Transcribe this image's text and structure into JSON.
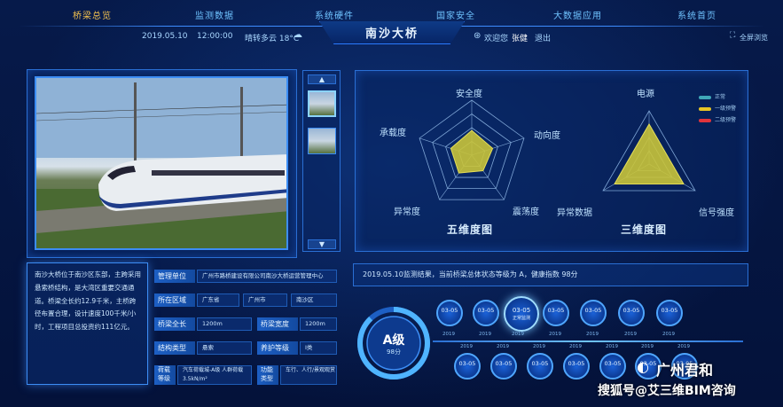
{
  "nav": {
    "items": [
      "桥梁总览",
      "监测数据",
      "系统硬件",
      "国家安全",
      "大数据应用",
      "系统首页"
    ],
    "active_index": 0
  },
  "infobar": {
    "date": "2019.05.10",
    "time": "12:00:00",
    "weather": "晴转多云 18°C",
    "welcome": "欢迎您",
    "user": "张健",
    "logout": "退出",
    "fullscreen": "全屏浏览"
  },
  "title": "南沙大桥",
  "radar1": {
    "labels": [
      "安全度",
      "动向度",
      "震荡度",
      "异常度",
      "承载度"
    ],
    "title": "五维度图",
    "values": [
      0.45,
      0.4,
      0.35,
      0.4,
      0.4
    ]
  },
  "radar2": {
    "labels": [
      "电源",
      "信号强度",
      "异常数据"
    ],
    "title": "三维度图",
    "values": [
      0.75,
      0.75,
      0.75
    ],
    "legend": [
      {
        "label": "正常",
        "color": "#3fa7b8"
      },
      {
        "label": "一级预警",
        "color": "#e6c425"
      },
      {
        "label": "二级预警",
        "color": "#e0343c"
      }
    ]
  },
  "description": "南沙大桥位于南沙区东部，主跨采用悬索桥结构，是大湾区重要交通通道。桥梁全长约12.9千米，主桥跨径布置合理，设计速度100千米/小时，工程项目总投资约111亿元。",
  "info": {
    "mgmt_label": "管理单位",
    "mgmt_value": "广州市路桥建设有限公司南沙大桥运营管理中心",
    "area_label": "所在区域",
    "area_value1": "广东省",
    "area_value2": "广州市",
    "area_value3": "南沙区",
    "length_label": "桥梁全长",
    "length_value": "1200m",
    "width_label": "桥梁宽度",
    "width_value": "1200m",
    "type_label": "结构类型",
    "type_value": "悬索",
    "guard_label": "养护等级",
    "guard_value": "I类",
    "load_label": "荷载等级",
    "load_value": "汽车荷载城-A级 人群荷载3.5kN/m²",
    "func_label": "功能类型",
    "func_value": "车行、人行/景观观赏"
  },
  "status_msg": "2019.05.10监测结果，当前桥梁总体状态等级为 A，健康指数 98分",
  "grade": {
    "level": "A级",
    "score": "98分"
  },
  "timeline_top": [
    {
      "date": "03-05",
      "year": "2019",
      "label": ""
    },
    {
      "date": "03-05",
      "year": "2019",
      "label": ""
    },
    {
      "date": "03-05",
      "year": "2019",
      "label": "正常监测"
    },
    {
      "date": "03-05",
      "year": "2019",
      "label": ""
    },
    {
      "date": "03-05",
      "year": "2019",
      "label": ""
    },
    {
      "date": "03-05",
      "year": "2019",
      "label": ""
    },
    {
      "date": "03-05",
      "year": "2019",
      "label": ""
    }
  ],
  "timeline_bottom": [
    {
      "date": "03-05",
      "year": "2019"
    },
    {
      "date": "03-05",
      "year": "2019"
    },
    {
      "date": "03-05",
      "year": "2019"
    },
    {
      "date": "03-05",
      "year": "2019"
    },
    {
      "date": "03-05",
      "year": "2019"
    },
    {
      "date": "03-05",
      "year": "2019"
    },
    {
      "date": "03-05",
      "year": "2019"
    }
  ],
  "watermark": {
    "brand": "广州君和",
    "source": "搜狐号@艾三维BIM咨询"
  },
  "colors": {
    "accent": "#3c8df5",
    "active": "#f2c14e",
    "radar_fill": "#c9c43a"
  }
}
